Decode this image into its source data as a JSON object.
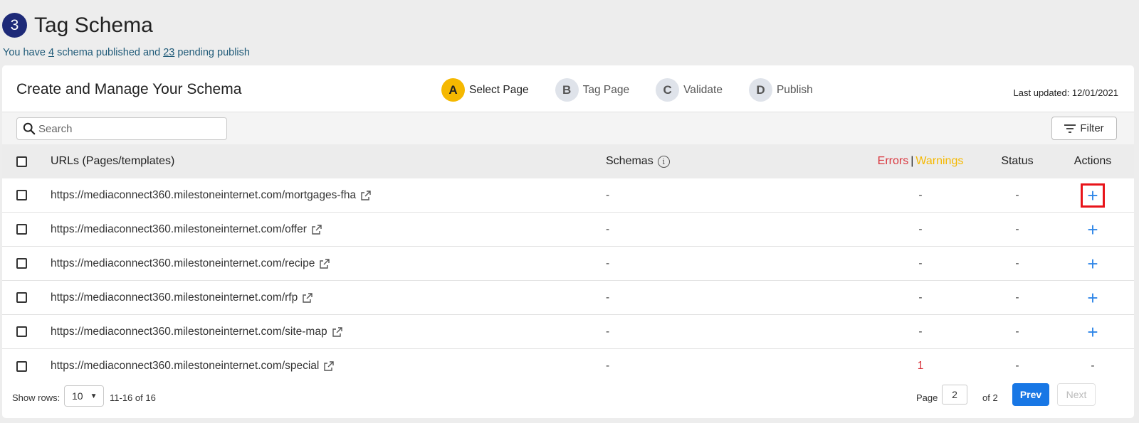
{
  "header": {
    "step_number": "3",
    "title": "Tag Schema",
    "subtitle_prefix": "You have ",
    "published_count": "4",
    "subtitle_mid": " schema published and ",
    "pending_count": "23",
    "subtitle_suffix": " pending publish"
  },
  "card": {
    "title": "Create and Manage Your Schema",
    "steps": [
      {
        "letter": "A",
        "label": "Select Page",
        "active": true
      },
      {
        "letter": "B",
        "label": "Tag Page",
        "active": false
      },
      {
        "letter": "C",
        "label": "Validate",
        "active": false
      },
      {
        "letter": "D",
        "label": "Publish",
        "active": false
      }
    ],
    "last_updated": "Last updated: 12/01/2021"
  },
  "toolbar": {
    "search_placeholder": "Search",
    "filter_label": "Filter"
  },
  "table": {
    "headers": {
      "url": "URLs (Pages/templates)",
      "schemas": "Schemas",
      "errors": "Errors",
      "separator": "|",
      "warnings": "Warnings",
      "status": "Status",
      "actions": "Actions"
    },
    "rows": [
      {
        "url": "https://mediaconnect360.milestoneinternet.com/mortgages-fha",
        "schemas": "-",
        "errors": "-",
        "status": "-",
        "action": "+"
      },
      {
        "url": "https://mediaconnect360.milestoneinternet.com/offer",
        "schemas": "-",
        "errors": "-",
        "status": "-",
        "action": "+"
      },
      {
        "url": "https://mediaconnect360.milestoneinternet.com/recipe",
        "schemas": "-",
        "errors": "-",
        "status": "-",
        "action": "+"
      },
      {
        "url": "https://mediaconnect360.milestoneinternet.com/rfp",
        "schemas": "-",
        "errors": "-",
        "status": "-",
        "action": "+"
      },
      {
        "url": "https://mediaconnect360.milestoneinternet.com/site-map",
        "schemas": "-",
        "errors": "-",
        "status": "-",
        "action": "+"
      },
      {
        "url": "https://mediaconnect360.milestoneinternet.com/special",
        "schemas": "-",
        "errors": "1",
        "status": "-",
        "action": "-"
      }
    ]
  },
  "pagination": {
    "show_rows_label": "Show rows:",
    "rows_value": "10",
    "range": "11-16 of 16",
    "page_label": "Page",
    "page_value": "2",
    "of_label": "of 2",
    "prev": "Prev",
    "next": "Next"
  },
  "colors": {
    "accent_blue": "#1877e5",
    "step_active": "#f5b800",
    "error_red": "#d9363e",
    "warning_yellow": "#f5b800",
    "highlight_red": "#e8141a"
  }
}
